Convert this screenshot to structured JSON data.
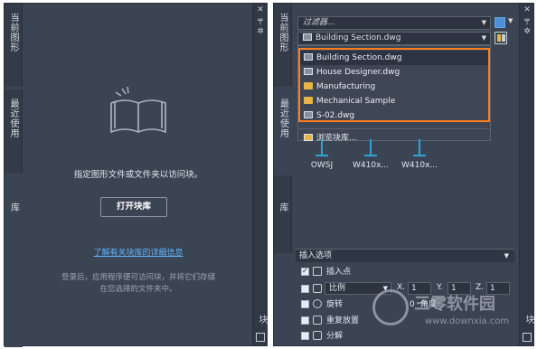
{
  "left_panel": {
    "tabs": [
      "当前图形",
      "最近使用",
      "库"
    ],
    "message": "指定图形文件或文件夹以访问块。",
    "open_library_button": "打开块库",
    "learn_more_link": "了解有关块库的详细信息",
    "hint_lines": [
      "登录后，应用程序便可访问块，并将它们存储",
      "在您选择的文件夹中。"
    ],
    "strip_icons": [
      "close-icon",
      "pin-icon",
      "gear-icon"
    ],
    "strip_label": "块"
  },
  "right_panel": {
    "tabs": [
      "当前图形",
      "最近使用",
      "库"
    ],
    "filter_placeholder": "过滤器...",
    "source_selected": "Building Section.dwg",
    "dropdown_items": [
      {
        "label": "Building Section.dwg",
        "icon": "file-icon"
      },
      {
        "label": "House Designer.dwg",
        "icon": "file-icon"
      },
      {
        "label": "Manufacturing",
        "icon": "folder-icon"
      },
      {
        "label": "Mechanical Sample",
        "icon": "folder-icon"
      },
      {
        "label": "S-02.dwg",
        "icon": "file-icon"
      }
    ],
    "browse_label": "浏览块库...",
    "blocks": [
      "OWSJ",
      "W410x...",
      "W410x..."
    ],
    "insert_options_title": "插入选项",
    "options": {
      "insertion_point": "插入点",
      "scale": "比例",
      "rotation": "旋转",
      "angle_label": "角度",
      "angle_value": "0",
      "repeat": "重复放置",
      "explode": "分解",
      "x_label": "X.",
      "y_label": "Y.",
      "z_label": "Z.",
      "x_value": "1",
      "y_value": "1",
      "z_value": "1"
    },
    "strip_label": "块"
  },
  "watermark": {
    "text_cn": "三零软件园",
    "text_url": "www.downxia.com"
  },
  "colors": {
    "panel": "#3b4453",
    "highlight": "#ff7f1f",
    "link": "#5fb3ff",
    "folder": "#e8b545"
  }
}
